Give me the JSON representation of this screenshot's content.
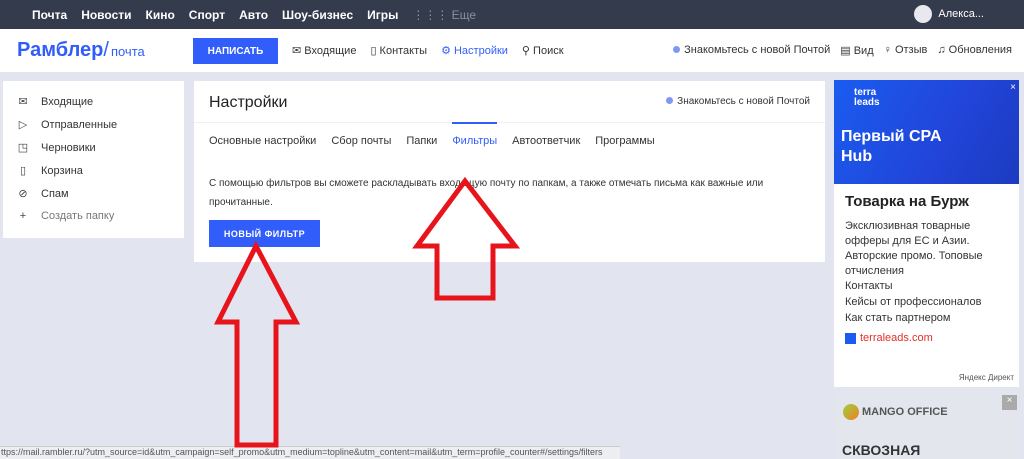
{
  "topbar": {
    "nav": [
      "Почта",
      "Новости",
      "Кино",
      "Спорт",
      "Авто",
      "Шоу-бизнес",
      "Игры"
    ],
    "more": "Еще",
    "user": "Алекса..."
  },
  "header": {
    "logo": "Рамблер",
    "logo_sub": "почта",
    "compose": "НАПИСАТЬ",
    "links": [
      "Входящие",
      "Контакты",
      "Настройки",
      "Поиск"
    ],
    "promo": "Знакомьтесь с новой Почтой",
    "right": [
      "Вид",
      "Отзыв",
      "Обновления"
    ]
  },
  "sidebar": {
    "items": [
      "Входящие",
      "Отправленные",
      "Черновики",
      "Корзина",
      "Спам",
      "Создать папку"
    ]
  },
  "main": {
    "title": "Настройки",
    "promo": "Знакомьтесь с новой Почтой",
    "tabs": [
      "Основные настройки",
      "Сбор почты",
      "Папки",
      "Фильтры",
      "Автоответчик",
      "Программы"
    ],
    "active_tab": "Фильтры",
    "description": "С помощью фильтров вы сможете раскладывать входящую почту по папкам, а также отмечать письма как важные или прочитанные.",
    "new_filter": "НОВЫЙ ФИЛЬТР"
  },
  "ad": {
    "brand": "terra leads",
    "banner": "Первый CPA Hub",
    "title": "Товарка на Бурж",
    "text": "Эксклюзивная товарные офферы для ЕС и Азии. Авторские промо. Топовые отчисления",
    "links": [
      "Контакты",
      "Кейсы от профессионалов",
      "Как стать партнером"
    ],
    "site": "terraleads.com",
    "source": "Яндекс Директ",
    "close": "×"
  },
  "ad2": {
    "brand": "MANGO OFFICE",
    "text": "СКВОЗНАЯ",
    "close": "×"
  },
  "status_url": "ttps://mail.rambler.ru/?utm_source=id&utm_campaign=self_promo&utm_medium=topline&utm_content=mail&utm_term=profile_counter#/settings/filters",
  "colors": {
    "accent": "#315efb",
    "topbar": "#343b4c",
    "annotation": "#e8141c"
  }
}
